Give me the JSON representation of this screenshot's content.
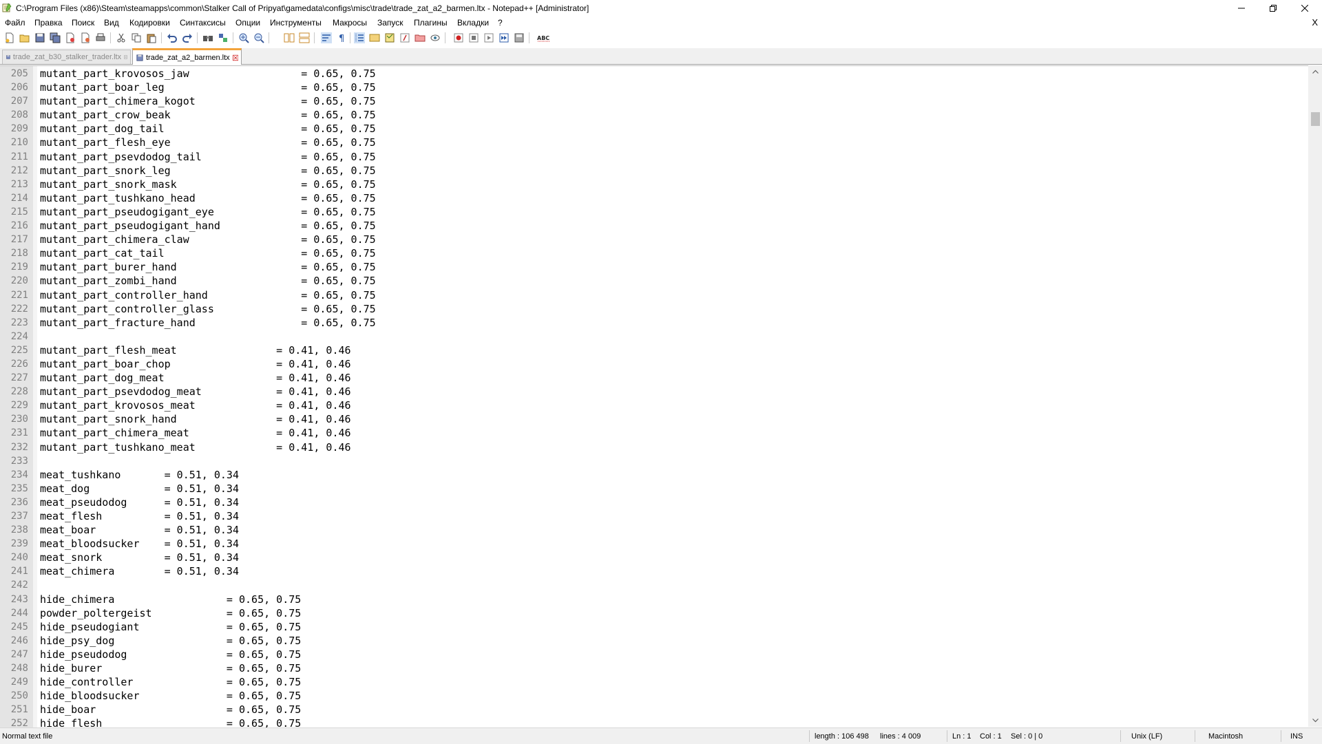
{
  "window": {
    "title": "C:\\Program Files (x86)\\Steam\\steamapps\\common\\Stalker Call of Pripyat\\gamedata\\configs\\misc\\trade\\trade_zat_a2_barmen.ltx - Notepad++ [Administrator]",
    "icon": "notepad-plus-plus-icon"
  },
  "menu": {
    "items": [
      "Файл",
      "Правка",
      "Поиск",
      "Вид",
      "Кодировки",
      "Синтаксисы",
      "Опции",
      "Инструменты",
      "Макросы",
      "Запуск",
      "Плагины",
      "Вкладки",
      "?"
    ],
    "close_doc": "X"
  },
  "tabs": [
    {
      "label": "trade_zat_b30_stalker_trader.ltx",
      "active": false
    },
    {
      "label": "trade_zat_a2_barmen.ltx",
      "active": true
    }
  ],
  "editor": {
    "lines": [
      {
        "n": "205",
        "t": "mutant_part_krovosos_jaw                  = 0.65, 0.75"
      },
      {
        "n": "206",
        "t": "mutant_part_boar_leg                      = 0.65, 0.75"
      },
      {
        "n": "207",
        "t": "mutant_part_chimera_kogot                 = 0.65, 0.75"
      },
      {
        "n": "208",
        "t": "mutant_part_crow_beak                     = 0.65, 0.75"
      },
      {
        "n": "209",
        "t": "mutant_part_dog_tail                      = 0.65, 0.75"
      },
      {
        "n": "210",
        "t": "mutant_part_flesh_eye                     = 0.65, 0.75"
      },
      {
        "n": "211",
        "t": "mutant_part_psevdodog_tail                = 0.65, 0.75"
      },
      {
        "n": "212",
        "t": "mutant_part_snork_leg                     = 0.65, 0.75"
      },
      {
        "n": "213",
        "t": "mutant_part_snork_mask                    = 0.65, 0.75"
      },
      {
        "n": "214",
        "t": "mutant_part_tushkano_head                 = 0.65, 0.75"
      },
      {
        "n": "215",
        "t": "mutant_part_pseudogigant_eye              = 0.65, 0.75"
      },
      {
        "n": "216",
        "t": "mutant_part_pseudogigant_hand             = 0.65, 0.75"
      },
      {
        "n": "217",
        "t": "mutant_part_chimera_claw                  = 0.65, 0.75"
      },
      {
        "n": "218",
        "t": "mutant_part_cat_tail                      = 0.65, 0.75"
      },
      {
        "n": "219",
        "t": "mutant_part_burer_hand                    = 0.65, 0.75"
      },
      {
        "n": "220",
        "t": "mutant_part_zombi_hand                    = 0.65, 0.75"
      },
      {
        "n": "221",
        "t": "mutant_part_controller_hand               = 0.65, 0.75"
      },
      {
        "n": "222",
        "t": "mutant_part_controller_glass              = 0.65, 0.75"
      },
      {
        "n": "223",
        "t": "mutant_part_fracture_hand                 = 0.65, 0.75"
      },
      {
        "n": "224",
        "t": ""
      },
      {
        "n": "225",
        "t": "mutant_part_flesh_meat                = 0.41, 0.46"
      },
      {
        "n": "226",
        "t": "mutant_part_boar_chop                 = 0.41, 0.46"
      },
      {
        "n": "227",
        "t": "mutant_part_dog_meat                  = 0.41, 0.46"
      },
      {
        "n": "228",
        "t": "mutant_part_psevdodog_meat            = 0.41, 0.46"
      },
      {
        "n": "229",
        "t": "mutant_part_krovosos_meat             = 0.41, 0.46"
      },
      {
        "n": "230",
        "t": "mutant_part_snork_hand                = 0.41, 0.46"
      },
      {
        "n": "231",
        "t": "mutant_part_chimera_meat              = 0.41, 0.46"
      },
      {
        "n": "232",
        "t": "mutant_part_tushkano_meat             = 0.41, 0.46"
      },
      {
        "n": "233",
        "t": ""
      },
      {
        "n": "234",
        "t": "meat_tushkano       = 0.51, 0.34"
      },
      {
        "n": "235",
        "t": "meat_dog            = 0.51, 0.34"
      },
      {
        "n": "236",
        "t": "meat_pseudodog      = 0.51, 0.34"
      },
      {
        "n": "237",
        "t": "meat_flesh          = 0.51, 0.34"
      },
      {
        "n": "238",
        "t": "meat_boar           = 0.51, 0.34"
      },
      {
        "n": "239",
        "t": "meat_bloodsucker    = 0.51, 0.34"
      },
      {
        "n": "240",
        "t": "meat_snork          = 0.51, 0.34"
      },
      {
        "n": "241",
        "t": "meat_chimera        = 0.51, 0.34"
      },
      {
        "n": "242",
        "t": ""
      },
      {
        "n": "243",
        "t": "hide_chimera                  = 0.65, 0.75"
      },
      {
        "n": "244",
        "t": "powder_poltergeist            = 0.65, 0.75"
      },
      {
        "n": "245",
        "t": "hide_pseudogiant              = 0.65, 0.75"
      },
      {
        "n": "246",
        "t": "hide_psy_dog                  = 0.65, 0.75"
      },
      {
        "n": "247",
        "t": "hide_pseudodog                = 0.65, 0.75"
      },
      {
        "n": "248",
        "t": "hide_burer                    = 0.65, 0.75"
      },
      {
        "n": "249",
        "t": "hide_controller               = 0.65, 0.75"
      },
      {
        "n": "250",
        "t": "hide_bloodsucker              = 0.65, 0.75"
      },
      {
        "n": "251",
        "t": "hide_boar                     = 0.65, 0.75"
      },
      {
        "n": "252",
        "t": "hide_flesh                    = 0.65, 0.75"
      }
    ]
  },
  "status": {
    "file_type": "Normal text file",
    "length": "length : 106 498",
    "lines": "lines : 4 009",
    "ln": "Ln : 1",
    "col": "Col : 1",
    "sel": "Sel : 0 | 0",
    "eol": "Unix (LF)",
    "encoding": "Macintosh",
    "mode": "INS"
  }
}
